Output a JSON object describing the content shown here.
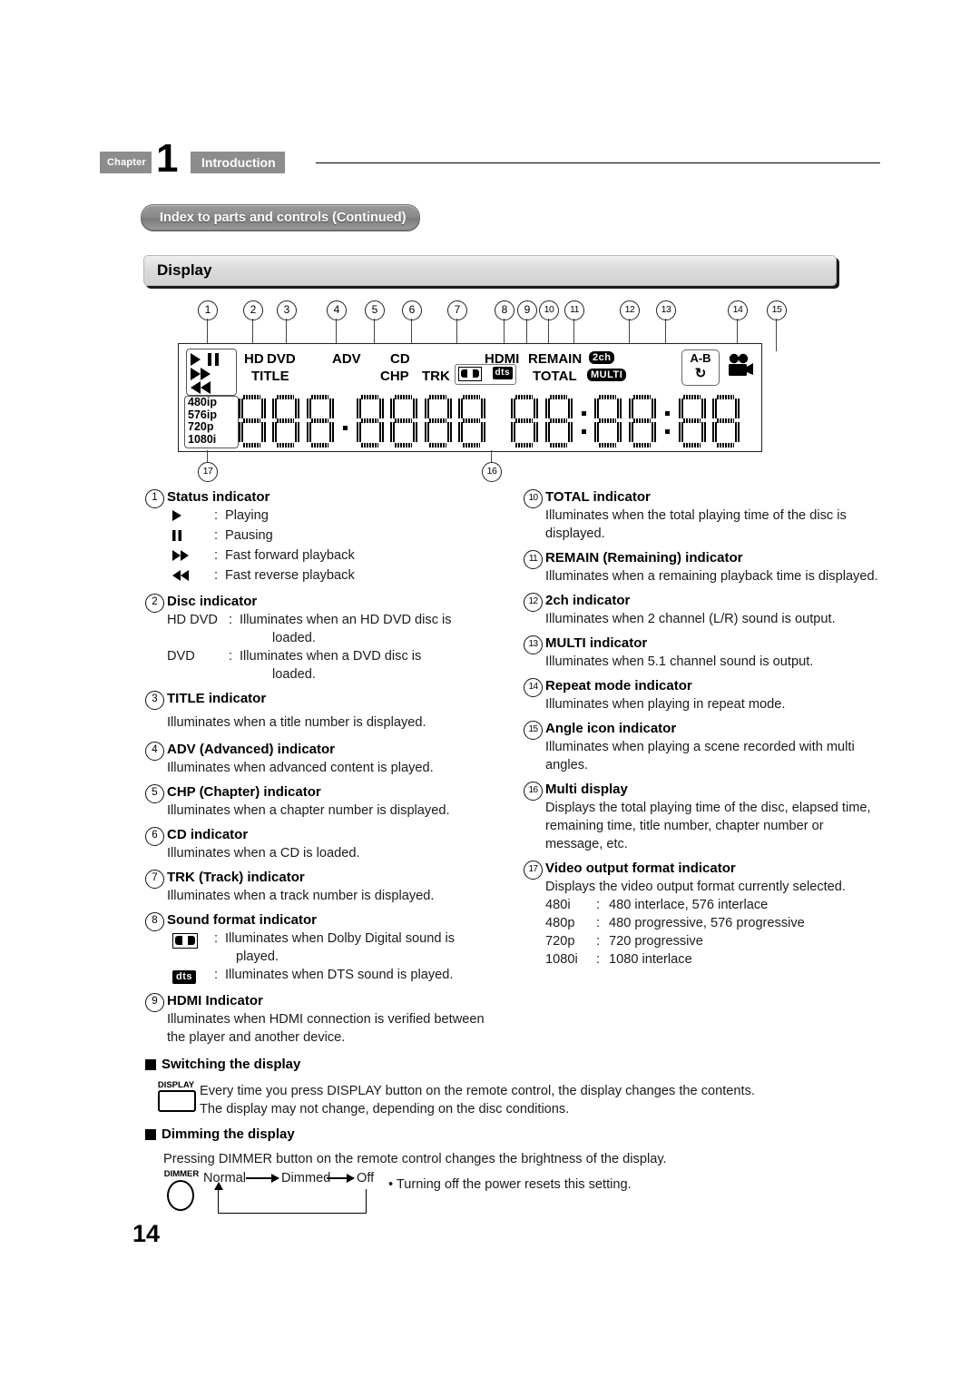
{
  "header": {
    "chapter_label": "Chapter",
    "chapter_number": "1",
    "chapter_title": "Introduction"
  },
  "section_pill": "Index to parts and controls (Continued)",
  "display_heading": "Display",
  "page_number": "14",
  "vfd_panel": {
    "callout_numbers_top": [
      "1",
      "2",
      "3",
      "4",
      "5",
      "6",
      "7",
      "8",
      "9",
      "10",
      "11",
      "12",
      "13",
      "14",
      "15"
    ],
    "callout_numbers_bottom": [
      "17",
      "16"
    ],
    "status_icons": [
      "play-icon",
      "pause-icon",
      "fast-forward-icon",
      "fast-reverse-icon"
    ],
    "video_format_labels": [
      "480ip",
      "576ip",
      "720p",
      "1080i"
    ],
    "indicator_labels": {
      "hd": "HD",
      "dvd": "DVD",
      "title": "TITLE",
      "adv": "ADV",
      "cd": "CD",
      "chp": "CHP",
      "trk": "TRK",
      "hdmi": "HDMI",
      "remain": "REMAIN",
      "total": "TOTAL",
      "two_ch": "2ch",
      "multi": "MULTI",
      "dts": "dts",
      "ab": "A-B",
      "repeat": "loop-icon",
      "angle": "camera-icon"
    }
  },
  "items_left": [
    {
      "num": "1",
      "title": "Status indicator",
      "sym_rows": [
        {
          "sym": "play-icon",
          "colon": ":",
          "text": "Playing"
        },
        {
          "sym": "pause-icon",
          "colon": ":",
          "text": "Pausing"
        },
        {
          "sym": "fast-forward-icon",
          "colon": ":",
          "text": "Fast forward playback"
        },
        {
          "sym": "fast-reverse-icon",
          "colon": ":",
          "text": "Fast reverse playback"
        }
      ]
    },
    {
      "num": "2",
      "title": "Disc indicator",
      "kv_rows": [
        {
          "k": "HD DVD",
          "c": ":",
          "v": "Illuminates when an HD DVD disc is",
          "cont": "loaded."
        },
        {
          "k": "DVD",
          "c": ":",
          "v": "Illuminates when a DVD disc is",
          "cont": "loaded."
        }
      ]
    },
    {
      "num": "3",
      "title": "TITLE indicator",
      "body": "Illuminates when a title number is displayed."
    },
    {
      "num": "4",
      "title": "ADV (Advanced) indicator",
      "body": "Illuminates when advanced content is played."
    },
    {
      "num": "5",
      "title": "CHP (Chapter) indicator",
      "body": "Illuminates when a chapter number is displayed."
    },
    {
      "num": "6",
      "title": "CD indicator",
      "body": "Illuminates when a CD is loaded."
    },
    {
      "num": "7",
      "title": "TRK (Track) indicator",
      "body": "Illuminates when a track number is displayed."
    },
    {
      "num": "8",
      "title": "Sound format indicator",
      "sound_rows": [
        {
          "sym": "dolby-digital-icon",
          "colon": ":",
          "text": "Illuminates when Dolby Digital sound is",
          "cont": "played."
        },
        {
          "sym": "dts-icon",
          "colon": ":",
          "text": "Illuminates when DTS sound is played.",
          "cont": ""
        }
      ]
    },
    {
      "num": "9",
      "title": "HDMI Indicator",
      "body": "Illuminates when HDMI connection is verified between the player and another device."
    }
  ],
  "items_right": [
    {
      "num": "10",
      "title": "TOTAL indicator",
      "body": "Illuminates when the total playing time of the disc is displayed."
    },
    {
      "num": "11",
      "title": "REMAIN (Remaining) indicator",
      "body": "Illuminates when a remaining playback time is displayed."
    },
    {
      "num": "12",
      "title": "2ch indicator",
      "body": "Illuminates when 2 channel (L/R) sound is output."
    },
    {
      "num": "13",
      "title": "MULTI indicator",
      "body": "Illuminates when 5.1 channel sound is output."
    },
    {
      "num": "14",
      "title": "Repeat mode indicator",
      "body": "Illuminates when playing in repeat mode."
    },
    {
      "num": "15",
      "title": "Angle icon indicator",
      "body": "Illuminates when playing a scene recorded with multi angles."
    },
    {
      "num": "16",
      "title": "Multi display",
      "body": "Displays the total playing time of the disc, elapsed time, remaining time, title number, chapter number or message, etc."
    },
    {
      "num": "17",
      "title": "Video output format indicator",
      "body": "Displays the video output format currently selected.",
      "fmt_rows": [
        {
          "k": "480i",
          "c": ":",
          "v": "480 interlace, 576 interlace"
        },
        {
          "k": "480p",
          "c": ":",
          "v": "480 progressive, 576 progressive"
        },
        {
          "k": "720p",
          "c": ":",
          "v": "720 progressive"
        },
        {
          "k": "1080i",
          "c": ":",
          "v": "1080 interlace"
        }
      ]
    }
  ],
  "switching": {
    "heading": "Switching the display",
    "button_label": "DISPLAY",
    "line1": "Every time you press DISPLAY button on the remote control, the display changes the contents.",
    "line2": "The display may not change, depending on the disc conditions."
  },
  "dimming": {
    "heading": "Dimming the display",
    "button_label": "DIMMER",
    "intro": "Pressing DIMMER button on the remote control changes the brightness of the display.",
    "states": [
      "Normal",
      "Dimmed",
      "Off"
    ],
    "note": "• Turning off the power resets this setting."
  }
}
